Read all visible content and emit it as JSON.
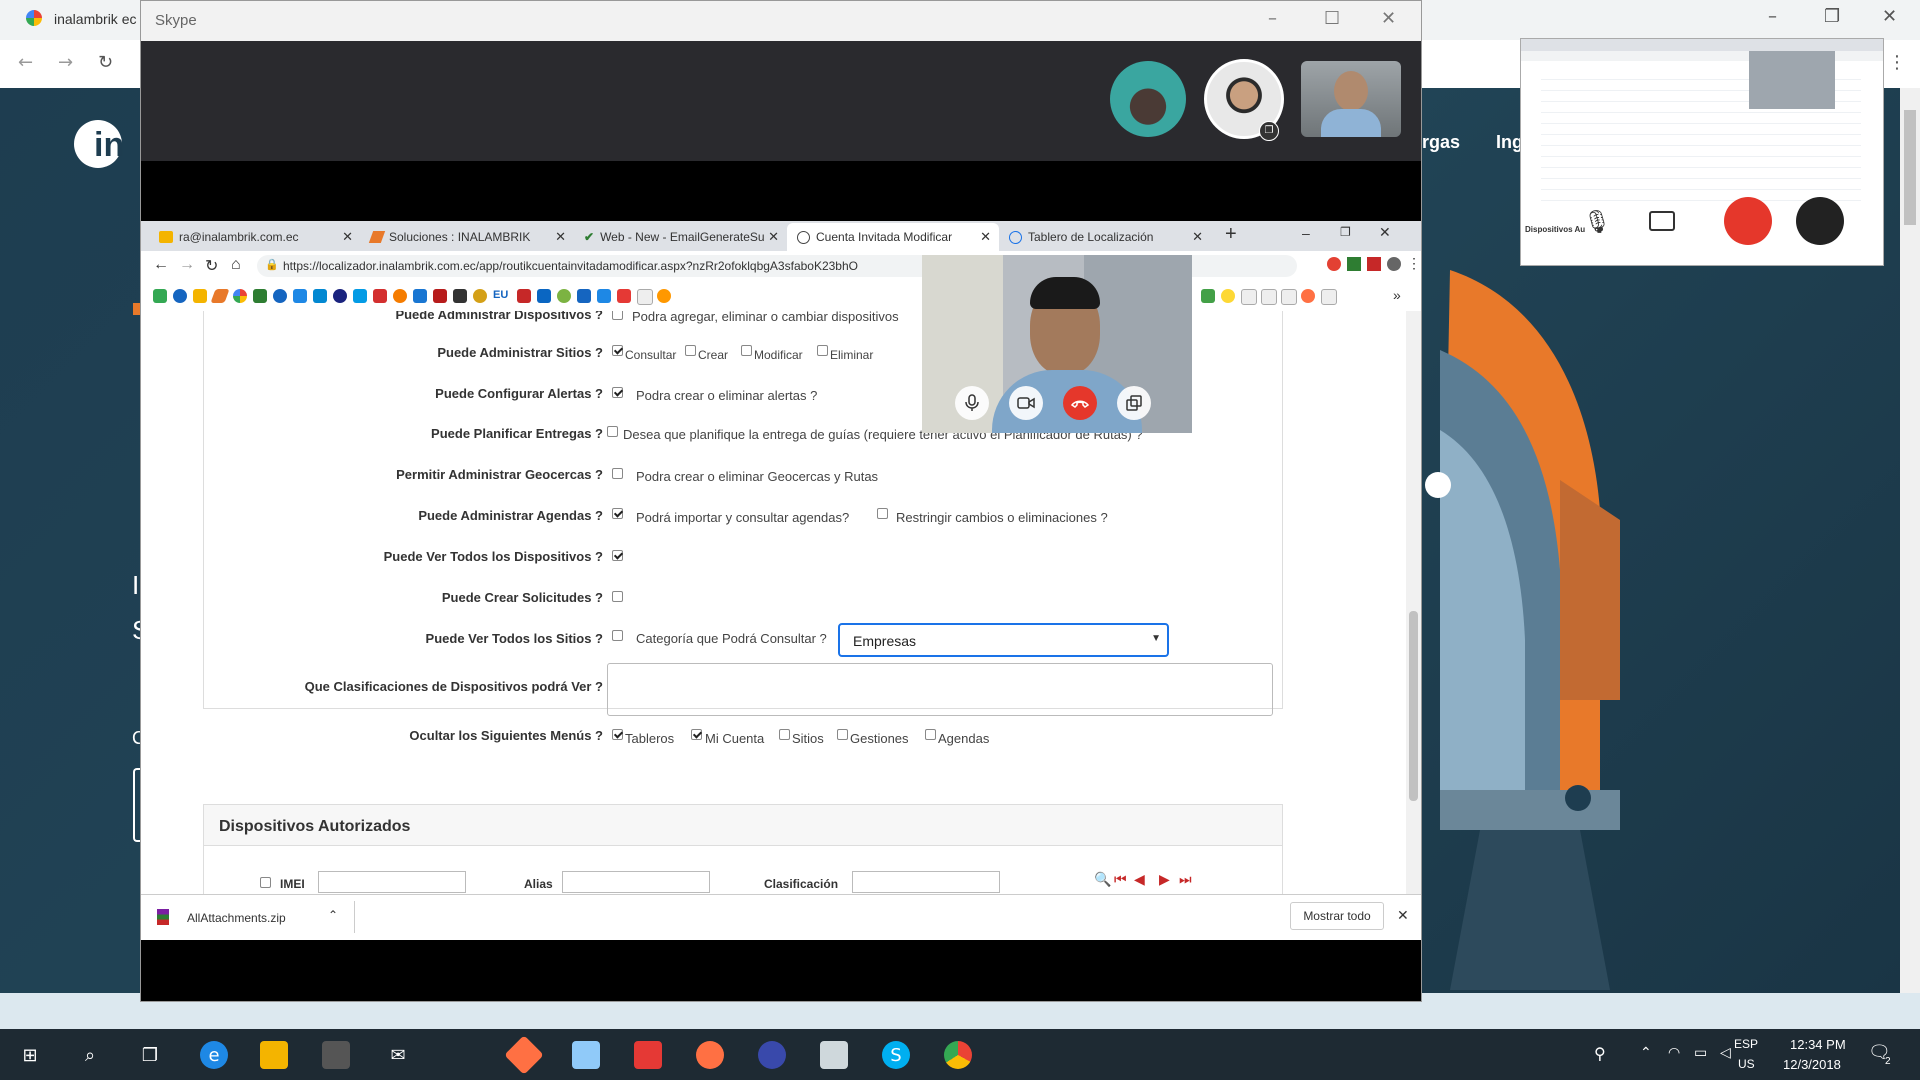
{
  "background_browser": {
    "tab_title": "inalambrik ec",
    "nav_items": [
      "rgas",
      "Ing"
    ],
    "side_letters": [
      "S",
      "I",
      "S",
      "C"
    ]
  },
  "skype": {
    "title": "Skype"
  },
  "chrome": {
    "tabs": [
      {
        "label": "ra@inalambrik.com.ec",
        "icon": "mail-icon"
      },
      {
        "label": "Soluciones : INALAMBRIK",
        "icon": "orange-logo-icon"
      },
      {
        "label": "Web - New - EmailGenerateSu",
        "icon": "check-icon"
      },
      {
        "label": "Cuenta Invitada Modificar",
        "icon": "globe-icon"
      },
      {
        "label": "Tablero de Localización",
        "icon": "globe-icon"
      }
    ],
    "url": "https://localizador.inalambrik.com.ec/app/routikcuentainvitadamodificar.aspx?nzRr2ofoklqbgA3sfaboK23bhO",
    "bookmark_labels": [
      "EU"
    ]
  },
  "form": {
    "rows": [
      {
        "label": "Puede Administrar Dispositivos ?",
        "text": "Podra agregar, eliminar o cambiar dispositivos"
      },
      {
        "label": "Puede Administrar Sitios ?",
        "options": [
          "Consultar",
          "Crear",
          "Modificar",
          "Eliminar"
        ]
      },
      {
        "label": "Puede Configurar Alertas ?",
        "text": "Podra crear o eliminar alertas ?"
      },
      {
        "label": "Puede Planificar Entregas ?",
        "text": "Desea que planifique la entrega de guías (requiere tener activo el Planificador de Rutas) ?"
      },
      {
        "label": "Permitir Administrar Geocercas ?",
        "text": "Podra crear o eliminar Geocercas y Rutas"
      },
      {
        "label": "Puede Administrar Agendas ?",
        "text": "Podrá importar y consultar agendas?",
        "extra": "Restringir cambios o eliminaciones ?"
      },
      {
        "label": "Puede Ver Todos los Dispositivos ?"
      },
      {
        "label": "Puede Crear Solicitudes ?"
      },
      {
        "label": "Puede Ver Todos los Sitios ?",
        "text": "Categoría que Podrá Consultar ?",
        "select": "Empresas"
      },
      {
        "label": "Que Clasificaciones de Dispositivos podrá Ver ?"
      },
      {
        "label": "Ocultar los Siguientes Menús ?",
        "options": [
          "Tableros",
          "Mi Cuenta",
          "Sitios",
          "Gestiones",
          "Agendas"
        ]
      }
    ],
    "section_title": "Dispositivos Autorizados",
    "filter_labels": [
      "IMEI",
      "Alias",
      "Clasificación"
    ]
  },
  "download": {
    "file": "AllAttachments.zip",
    "show_all": "Mostrar todo"
  },
  "taskbar": {
    "lang": "ESP",
    "region": "US",
    "time": "12:34 PM",
    "date": "12/3/2018",
    "notif_count": "2"
  },
  "thumbnail": {
    "label": "Dispositivos Au"
  }
}
